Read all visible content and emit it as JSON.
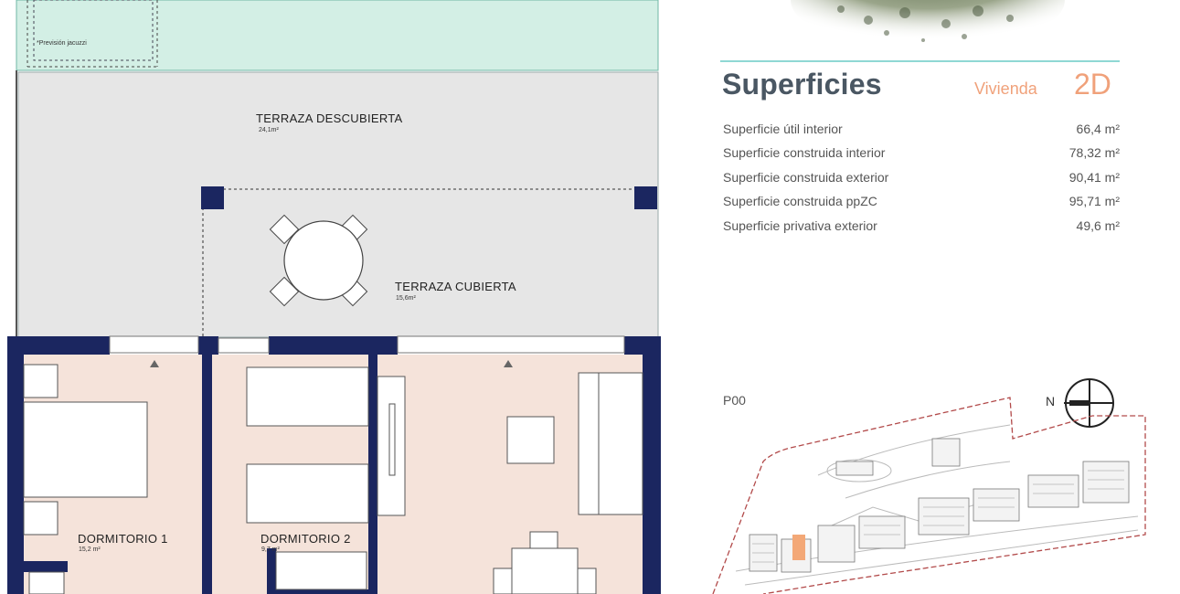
{
  "plan": {
    "jacuzzi_note": "*Previsión jacuzzi",
    "terrace_open": {
      "name": "TERRAZA DESCUBIERTA",
      "area": "24,1m²"
    },
    "terrace_covered": {
      "name": "TERRAZA CUBIERTA",
      "area": "15,6m²"
    },
    "bedroom1": {
      "name": "DORMITORIO 1",
      "area": "15,2 m²"
    },
    "bedroom2": {
      "name": "DORMITORIO 2",
      "area": "9,7 m²"
    }
  },
  "summary": {
    "title": "Superficies",
    "unit_label": "Vivienda",
    "unit_code": "2D",
    "rows": [
      {
        "label": "Superficie útil interior",
        "value": "66,4 m²"
      },
      {
        "label": "Superficie construida interior",
        "value": "78,32 m²"
      },
      {
        "label": "Superficie construida exterior",
        "value": "90,41 m²"
      },
      {
        "label": "Superficie construida ppZC",
        "value": "95,71 m²"
      },
      {
        "label": "Superficie privativa exterior",
        "value": "49,6 m²"
      }
    ]
  },
  "site_map": {
    "level": "P00",
    "north_label": "N"
  },
  "colors": {
    "garden": "#d3efe5",
    "terrace": "#e6e6e6",
    "room_floor": "#f5e3da",
    "wall": "#1b2660",
    "accent": "#f0a17a",
    "title": "#4a5763",
    "rule": "#8fd8d4",
    "highlight_unit": "#f3a877"
  }
}
